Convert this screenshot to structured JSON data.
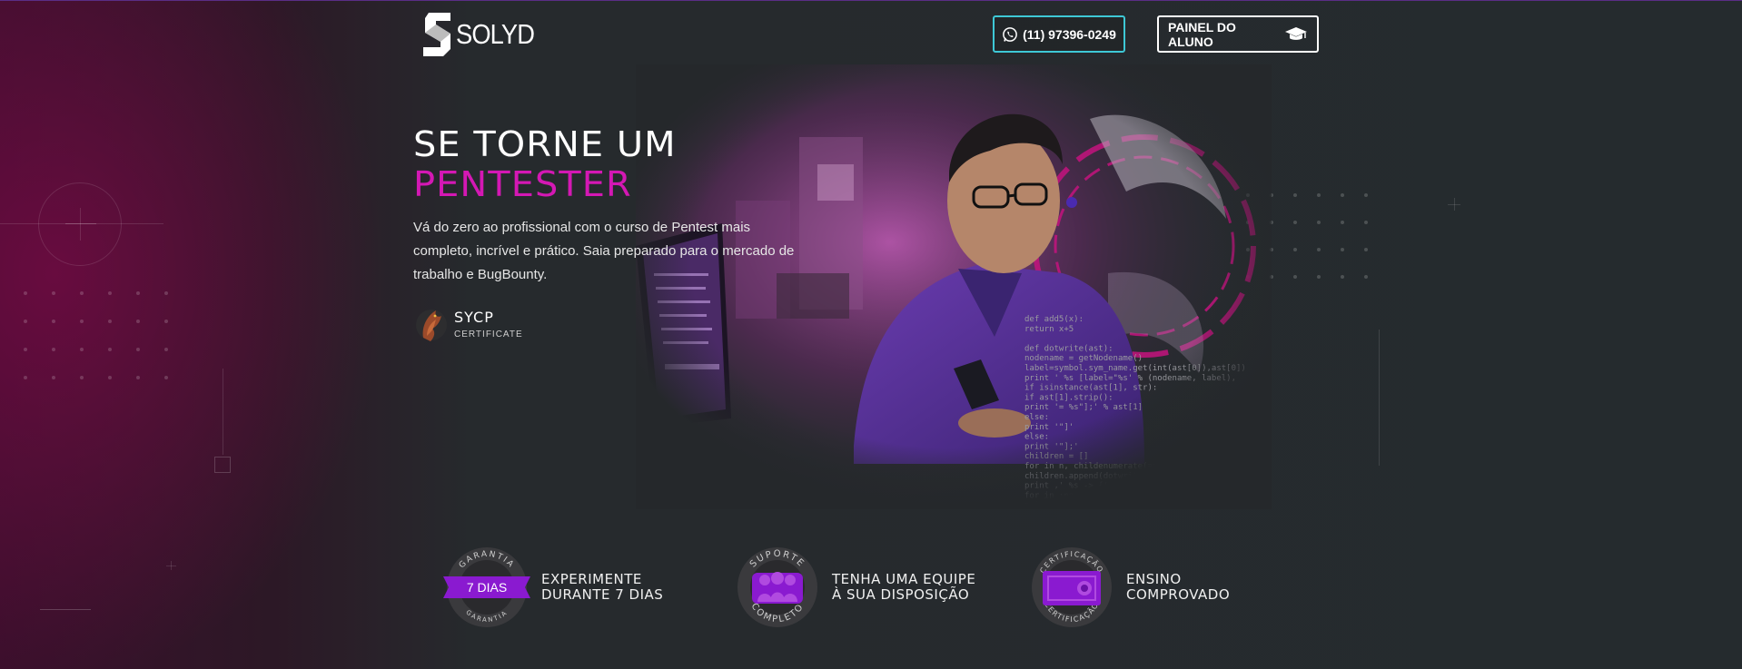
{
  "header": {
    "logo_text": "SOLYD",
    "phone_label": "(11) 97396-0249",
    "student_panel_label": "PAINEL DO ALUNO"
  },
  "hero": {
    "title_line1": "SE TORNE UM",
    "title_line2": "PENTESTER",
    "description": "Vá do zero ao profissional com o curso de Pentest mais completo, incrível e prático. Saia preparado para o mercado de trabalho e BugBounty.",
    "certificate": {
      "name": "SYCP",
      "subtitle": "CERTIFICATE"
    },
    "code_lines": [
      "def add5(x):",
      "  return x+5",
      "",
      "def dotwrite(ast):",
      "  nodename = getNodename()",
      "  label=symbol.sym_name.get(int(ast[0]),ast[0])",
      "  print '  %s [label=\"%s' % (nodename, label),",
      "  if isinstance(ast[1], str):",
      "    if ast[1].strip():",
      "      print '= %s\"];' % ast[1]",
      "    else:",
      "      print '\"]'",
      "  else:",
      "    print '\"];'",
      "    children = []",
      "    for  in n, childenumerate(ast[1:]):",
      "      children.append(dotwrite(child))",
      "    print ,'   %s -> {' % nodename",
      "    for  in :namechildren",
      "      print '%s' % name,"
    ]
  },
  "features": [
    {
      "badge_ring_top": "GARANTIA",
      "badge_ring_bottom": "GARANTIA",
      "badge_label": "7 DIAS",
      "line1": "EXPERIMENTE",
      "line2": "DURANTE 7 DIAS"
    },
    {
      "badge_ring_top": "SUPORTE",
      "badge_ring_bottom": "COMPLETO",
      "line1": "TENHA UMA EQUIPE",
      "line2": "À SUA DISPOSIÇÃO"
    },
    {
      "badge_ring_top": "CERTIFICAÇÃO",
      "badge_ring_bottom": "CERTIFICAÇÃO",
      "line1": "ENSINO",
      "line2": "COMPROVADO"
    }
  ],
  "colors": {
    "accent_pink": "#d418b4",
    "accent_cyan": "#3ec8d6",
    "purple": "#8a1ad0"
  },
  "icons": {
    "phone": "whatsapp-icon",
    "student_panel": "graduation-cap-icon"
  }
}
